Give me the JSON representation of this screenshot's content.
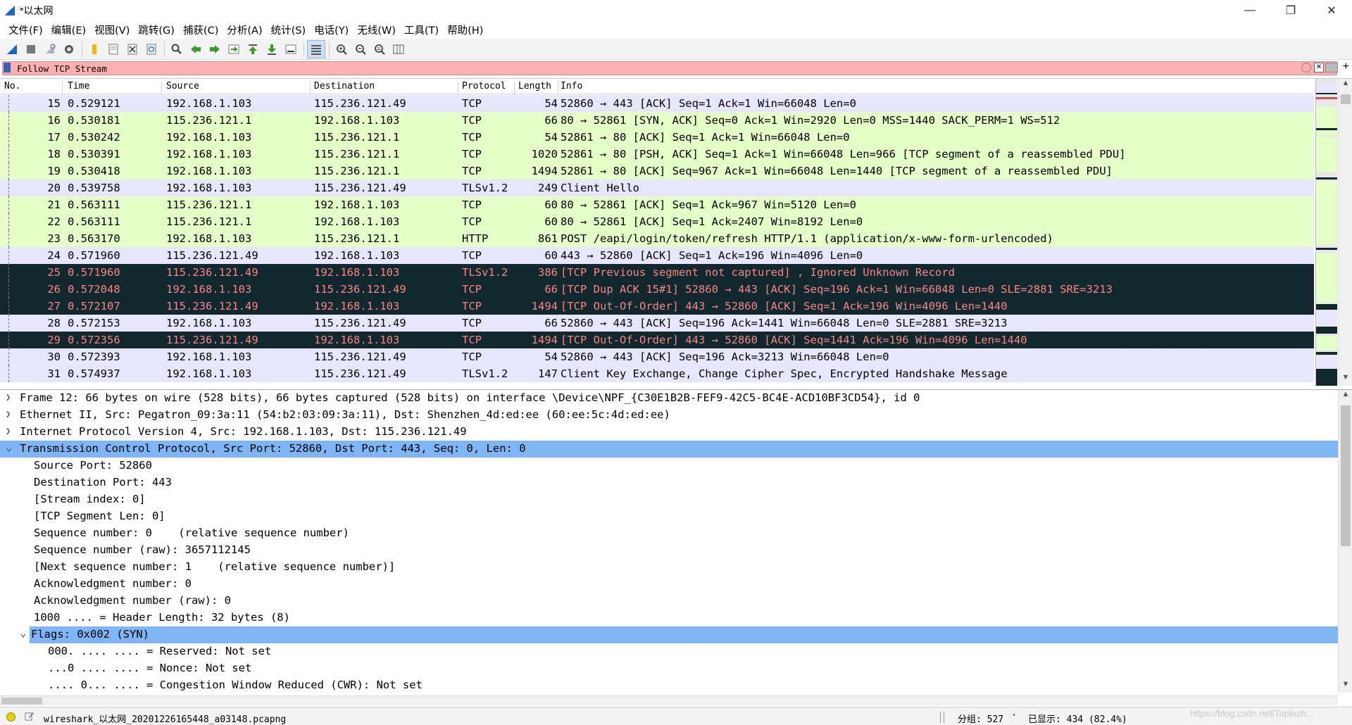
{
  "window": {
    "title": "*以太网"
  },
  "menu": [
    "文件(F)",
    "编辑(E)",
    "视图(V)",
    "跳转(G)",
    "捕获(C)",
    "分析(A)",
    "统计(S)",
    "电话(Y)",
    "无线(W)",
    "工具(T)",
    "帮助(H)"
  ],
  "filter": {
    "value": "Follow TCP Stream"
  },
  "columns": {
    "no": "No.",
    "time": "Time",
    "source": "Source",
    "destination": "Destination",
    "protocol": "Protocol",
    "length": "Length",
    "info": "Info"
  },
  "packets": [
    {
      "no": "15",
      "time": "0.529121",
      "src": "192.168.1.103",
      "dst": "115.236.121.49",
      "proto": "TCP",
      "len": "54",
      "info": "52860 → 443 [ACK] Seq=1 Ack=1 Win=66048 Len=0",
      "style": "tcp"
    },
    {
      "no": "16",
      "time": "0.530181",
      "src": "115.236.121.1",
      "dst": "192.168.1.103",
      "proto": "TCP",
      "len": "66",
      "info": "80 → 52861 [SYN, ACK] Seq=0 Ack=1 Win=2920 Len=0 MSS=1440 SACK_PERM=1 WS=512",
      "style": "http"
    },
    {
      "no": "17",
      "time": "0.530242",
      "src": "192.168.1.103",
      "dst": "115.236.121.1",
      "proto": "TCP",
      "len": "54",
      "info": "52861 → 80 [ACK] Seq=1 Ack=1 Win=66048 Len=0",
      "style": "http"
    },
    {
      "no": "18",
      "time": "0.530391",
      "src": "192.168.1.103",
      "dst": "115.236.121.1",
      "proto": "TCP",
      "len": "1020",
      "info": "52861 → 80 [PSH, ACK] Seq=1 Ack=1 Win=66048 Len=966 [TCP segment of a reassembled PDU]",
      "style": "http"
    },
    {
      "no": "19",
      "time": "0.530418",
      "src": "192.168.1.103",
      "dst": "115.236.121.1",
      "proto": "TCP",
      "len": "1494",
      "info": "52861 → 80 [ACK] Seq=967 Ack=1 Win=66048 Len=1440 [TCP segment of a reassembled PDU]",
      "style": "http"
    },
    {
      "no": "20",
      "time": "0.539758",
      "src": "192.168.1.103",
      "dst": "115.236.121.49",
      "proto": "TLSv1.2",
      "len": "249",
      "info": "Client Hello",
      "style": "tcp"
    },
    {
      "no": "21",
      "time": "0.563111",
      "src": "115.236.121.1",
      "dst": "192.168.1.103",
      "proto": "TCP",
      "len": "60",
      "info": "80 → 52861 [ACK] Seq=1 Ack=967 Win=5120 Len=0",
      "style": "http"
    },
    {
      "no": "22",
      "time": "0.563111",
      "src": "115.236.121.1",
      "dst": "192.168.1.103",
      "proto": "TCP",
      "len": "60",
      "info": "80 → 52861 [ACK] Seq=1 Ack=2407 Win=8192 Len=0",
      "style": "http"
    },
    {
      "no": "23",
      "time": "0.563170",
      "src": "192.168.1.103",
      "dst": "115.236.121.1",
      "proto": "HTTP",
      "len": "861",
      "info": "POST /eapi/login/token/refresh HTTP/1.1  (application/x-www-form-urlencoded)",
      "style": "http"
    },
    {
      "no": "24",
      "time": "0.571960",
      "src": "115.236.121.49",
      "dst": "192.168.1.103",
      "proto": "TCP",
      "len": "60",
      "info": "443 → 52860 [ACK] Seq=1 Ack=196 Win=4096 Len=0",
      "style": "tcp"
    },
    {
      "no": "25",
      "time": "0.571960",
      "src": "115.236.121.49",
      "dst": "192.168.1.103",
      "proto": "TLSv1.2",
      "len": "386",
      "info": "[TCP Previous segment not captured] , Ignored Unknown Record",
      "style": "bad"
    },
    {
      "no": "26",
      "time": "0.572048",
      "src": "192.168.1.103",
      "dst": "115.236.121.49",
      "proto": "TCP",
      "len": "66",
      "info": "[TCP Dup ACK 15#1] 52860 → 443 [ACK] Seq=196 Ack=1 Win=66048 Len=0 SLE=2881 SRE=3213",
      "style": "bad"
    },
    {
      "no": "27",
      "time": "0.572107",
      "src": "115.236.121.49",
      "dst": "192.168.1.103",
      "proto": "TCP",
      "len": "1494",
      "info": "[TCP Out-Of-Order] 443 → 52860 [ACK] Seq=1 Ack=196 Win=4096 Len=1440",
      "style": "bad"
    },
    {
      "no": "28",
      "time": "0.572153",
      "src": "192.168.1.103",
      "dst": "115.236.121.49",
      "proto": "TCP",
      "len": "66",
      "info": "52860 → 443 [ACK] Seq=196 Ack=1441 Win=66048 Len=0 SLE=2881 SRE=3213",
      "style": "tcp"
    },
    {
      "no": "29",
      "time": "0.572356",
      "src": "115.236.121.49",
      "dst": "192.168.1.103",
      "proto": "TCP",
      "len": "1494",
      "info": "[TCP Out-Of-Order] 443 → 52860 [ACK] Seq=1441 Ack=196 Win=4096 Len=1440",
      "style": "bad"
    },
    {
      "no": "30",
      "time": "0.572393",
      "src": "192.168.1.103",
      "dst": "115.236.121.49",
      "proto": "TCP",
      "len": "54",
      "info": "52860 → 443 [ACK] Seq=196 Ack=3213 Win=66048 Len=0",
      "style": "tcp"
    },
    {
      "no": "31",
      "time": "0.574937",
      "src": "192.168.1.103",
      "dst": "115.236.121.49",
      "proto": "TLSv1.2",
      "len": "147",
      "info": "Client Key Exchange, Change Cipher Spec, Encrypted Handshake Message",
      "style": "tcp"
    }
  ],
  "details": [
    {
      "text": "Frame 12: 66 bytes on wire (528 bits), 66 bytes captured (528 bits) on interface \\Device\\NPF_{C30E1B2B-FEF9-42C5-BC4E-ACD10BF3CD54}, id 0",
      "level": 0,
      "toggle": "collapsed",
      "selected": false
    },
    {
      "text": "Ethernet II, Src: Pegatron_09:3a:11 (54:b2:03:09:3a:11), Dst: Shenzhen_4d:ed:ee (60:ee:5c:4d:ed:ee)",
      "level": 0,
      "toggle": "collapsed",
      "selected": false
    },
    {
      "text": "Internet Protocol Version 4, Src: 192.168.1.103, Dst: 115.236.121.49",
      "level": 0,
      "toggle": "collapsed",
      "selected": false
    },
    {
      "text": "Transmission Control Protocol, Src Port: 52860, Dst Port: 443, Seq: 0, Len: 0",
      "level": 0,
      "toggle": "expanded",
      "selected": true
    },
    {
      "text": "Source Port: 52860",
      "level": 1,
      "toggle": "none",
      "selected": false
    },
    {
      "text": "Destination Port: 443",
      "level": 1,
      "toggle": "none",
      "selected": false
    },
    {
      "text": "[Stream index: 0]",
      "level": 1,
      "toggle": "none",
      "selected": false
    },
    {
      "text": "[TCP Segment Len: 0]",
      "level": 1,
      "toggle": "none",
      "selected": false
    },
    {
      "text": "Sequence number: 0    (relative sequence number)",
      "level": 1,
      "toggle": "none",
      "selected": false
    },
    {
      "text": "Sequence number (raw): 3657112145",
      "level": 1,
      "toggle": "none",
      "selected": false
    },
    {
      "text": "[Next sequence number: 1    (relative sequence number)]",
      "level": 1,
      "toggle": "none",
      "selected": false
    },
    {
      "text": "Acknowledgment number: 0",
      "level": 1,
      "toggle": "none",
      "selected": false
    },
    {
      "text": "Acknowledgment number (raw): 0",
      "level": 1,
      "toggle": "none",
      "selected": false
    },
    {
      "text": "1000 .... = Header Length: 32 bytes (8)",
      "level": 1,
      "toggle": "none",
      "selected": false
    },
    {
      "text": "Flags: 0x002 (SYN)",
      "level": 1,
      "toggle": "expanded",
      "selected": true
    },
    {
      "text": "000. .... .... = Reserved: Not set",
      "level": 2,
      "toggle": "none",
      "selected": false
    },
    {
      "text": "...0 .... .... = Nonce: Not set",
      "level": 2,
      "toggle": "none",
      "selected": false
    },
    {
      "text": ".... 0... .... = Congestion Window Reduced (CWR): Not set",
      "level": 2,
      "toggle": "none",
      "selected": false
    }
  ],
  "status": {
    "file": "wireshark_以太网_20201226165448_a03148.pcapng",
    "packets": "分组: 527",
    "sep": "·",
    "displayed": "已显示: 434 (82.4%)",
    "watermark": "https://blog.csdn.net/Topkuth..."
  },
  "colors": {
    "tcp_row": "#e7e6ff",
    "http_row": "#e4ffc7",
    "bad_row": "#12272e",
    "bad_text": "#f78787",
    "selected": "#7fb4f5",
    "filter_bg": "#ffafaf"
  }
}
